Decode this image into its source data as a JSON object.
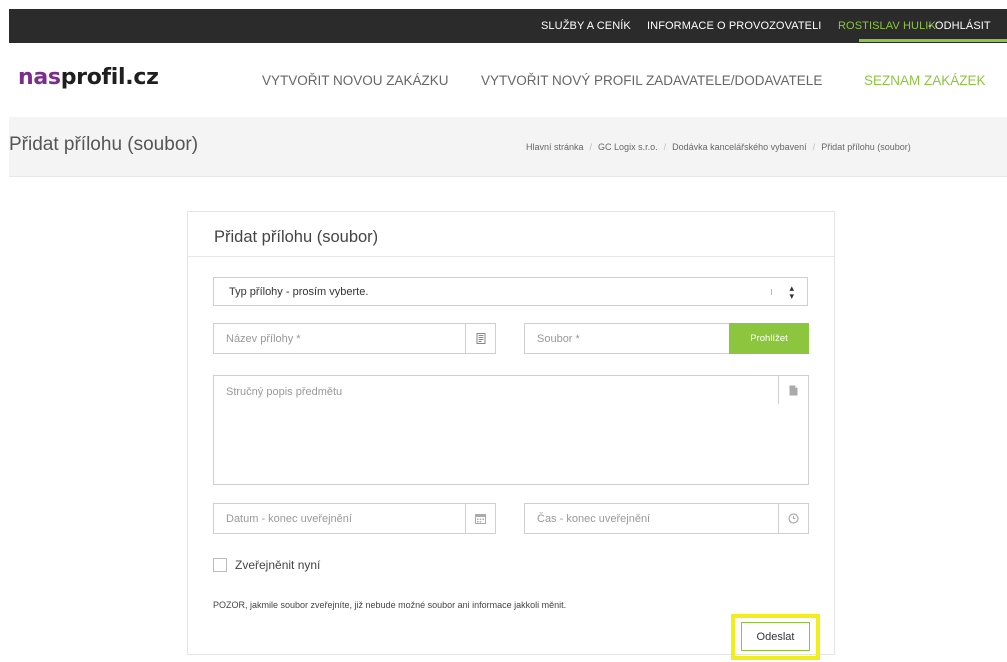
{
  "topbar": {
    "services": "SLUŽBY A CENÍK",
    "operator_info": "INFORMACE O PROVOZOVATELI",
    "user": "ROSTISLAV HULIK",
    "logout": " - ODHLÁSIT",
    "accent_color": "#8cc63f"
  },
  "header": {
    "logo_part1": "nas",
    "logo_part2": "profil.cz",
    "nav": {
      "new_contract": "VYTVOŘIT NOVOU ZAKÁZKU",
      "new_profile": "VYTVOŘIT NOVÝ PROFIL ZADAVATELE/DODAVATELE",
      "contract_list": "SEZNAM ZAKÁZEK"
    }
  },
  "titlebar": {
    "title": "Přidat přílohu (soubor)",
    "breadcrumb": [
      "Hlavní stránka",
      "GC Logix s.r.o.",
      "Dodávka kancelářského vybavení",
      "Přidat přílohu (soubor)"
    ]
  },
  "form": {
    "heading": "Přidat přílohu (soubor)",
    "type_select": {
      "value": "Typ přílohy - prosím vyberte."
    },
    "name_field": {
      "placeholder": "Název přílohy *",
      "icon": "document-icon"
    },
    "file_field": {
      "placeholder": "Soubor *",
      "browse_label": "Prohlížet"
    },
    "description": {
      "placeholder": "Stručný popis předmětu",
      "icon": "file-icon"
    },
    "date_field": {
      "placeholder": "Datum - konec uveřejnění",
      "icon": "calendar-icon"
    },
    "time_field": {
      "placeholder": "Čas - konec uveřejnění",
      "icon": "clock-icon"
    },
    "publish_now": {
      "label": "Zveřejněnit nyní",
      "checked": false
    },
    "warning": "POZOR, jakmile soubor zveřejníte, již nebude možné soubor ani informace jakkoli měnit.",
    "submit_label": "Odeslat",
    "highlight_color": "#f2ee1c"
  }
}
